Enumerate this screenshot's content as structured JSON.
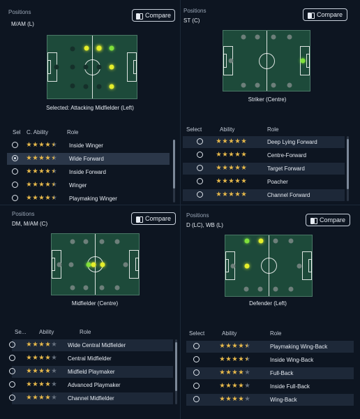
{
  "colors": {
    "background": "#0d1521",
    "pitch": "#1d4a3a",
    "star": "#e7b94b",
    "highlight_yellow": "#e4ee2b",
    "highlight_green": "#7fe03b"
  },
  "panels": [
    {
      "positions_label": "Positions",
      "positions_value": "M/AM (L)",
      "compare_label": "Compare",
      "compare_icon": "compare-icon",
      "caption": "Selected: Attacking Midfielder (Left)",
      "headers": {
        "select": "Sel",
        "ability": "C. Ability",
        "role": "Role"
      },
      "rows": [
        {
          "selected": false,
          "stars": 4.5,
          "role": "Inside Winger"
        },
        {
          "selected": true,
          "stars": 4.5,
          "role": "Wide Forward"
        },
        {
          "selected": false,
          "stars": 4.5,
          "role": "Inside Forward"
        },
        {
          "selected": false,
          "stars": 4.5,
          "role": "Winger"
        },
        {
          "selected": false,
          "stars": 4.5,
          "role": "Playmaking Winger"
        }
      ]
    },
    {
      "positions_label": "Positions",
      "positions_value": "ST (C)",
      "compare_label": "Compare",
      "compare_icon": "compare-icon",
      "caption": "Striker (Centre)",
      "headers": {
        "select": "Select",
        "ability": "Ability",
        "role": "Role"
      },
      "rows": [
        {
          "selected": false,
          "stars": 5,
          "role": "Deep Lying Forward"
        },
        {
          "selected": false,
          "stars": 5,
          "role": "Centre-Forward"
        },
        {
          "selected": false,
          "stars": 5,
          "role": "Target Forward"
        },
        {
          "selected": false,
          "stars": 5,
          "role": "Poacher"
        },
        {
          "selected": false,
          "stars": 5,
          "role": "Channel Forward"
        }
      ]
    },
    {
      "positions_label": "Positions",
      "positions_value": "DM, M/AM (C)",
      "compare_label": "Compare",
      "compare_icon": "compare-icon",
      "caption": "Midfielder (Centre)",
      "headers": {
        "select": "Se...",
        "ability": "Ability",
        "role": "Role"
      },
      "rows": [
        {
          "selected": false,
          "stars": 4,
          "role": "Wide Central Midfielder"
        },
        {
          "selected": false,
          "stars": 4,
          "role": "Central Midfielder"
        },
        {
          "selected": false,
          "stars": 4,
          "role": "Midfield Playmaker"
        },
        {
          "selected": false,
          "stars": 4,
          "role": "Advanced Playmaker"
        },
        {
          "selected": false,
          "stars": 4,
          "role": "Channel Midfielder"
        }
      ]
    },
    {
      "positions_label": "Positions",
      "positions_value": "D (LC), WB (L)",
      "compare_label": "Compare",
      "compare_icon": "compare-icon",
      "caption": "Defender (Left)",
      "headers": {
        "select": "Select",
        "ability": "Ability",
        "role": "Role"
      },
      "rows": [
        {
          "selected": false,
          "stars": 4.5,
          "role": "Playmaking Wing-Back"
        },
        {
          "selected": false,
          "stars": 4.5,
          "role": "Inside Wing-Back"
        },
        {
          "selected": false,
          "stars": 4,
          "role": "Full-Back"
        },
        {
          "selected": false,
          "stars": 4,
          "role": "Inside Full-Back"
        },
        {
          "selected": false,
          "stars": 4,
          "role": "Wing-Back"
        }
      ]
    }
  ]
}
